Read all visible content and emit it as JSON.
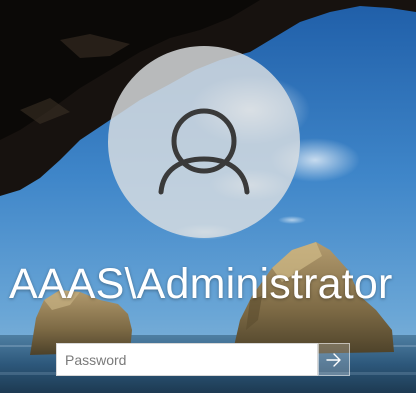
{
  "login": {
    "username": "AAAS\\Administrator",
    "password_placeholder": "Password"
  },
  "icons": {
    "avatar": "user-silhouette-icon",
    "submit": "arrow-right-icon"
  },
  "colors": {
    "sky": "#2f6fb3",
    "sea": "#2a4a66",
    "cave": "#14110f",
    "avatar_circle": "#dcdfe2",
    "text": "#ffffff"
  }
}
